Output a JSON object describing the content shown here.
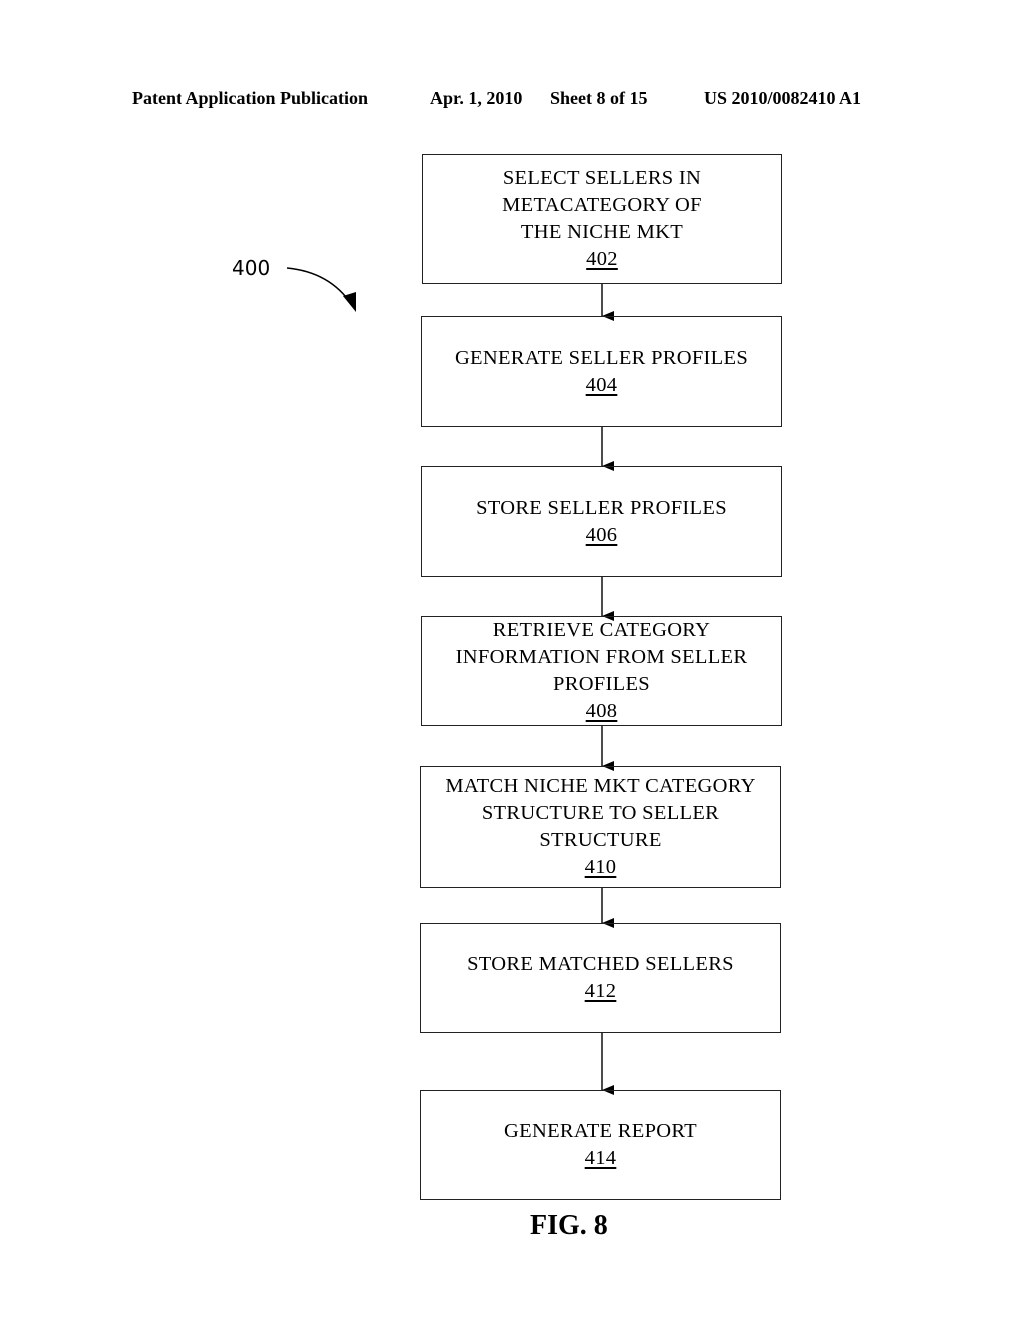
{
  "header": {
    "publication": "Patent Application Publication",
    "date": "Apr. 1, 2010",
    "sheet": "Sheet 8 of 15",
    "number": "US 2010/0082410 A1"
  },
  "diagram": {
    "reference_label": "400",
    "figure_label": "FIG. 8",
    "steps": [
      {
        "lines": [
          "SELECT SELLERS IN",
          "METACATEGORY OF",
          "THE NICHE MKT"
        ],
        "ref": "402"
      },
      {
        "lines": [
          "GENERATE SELLER PROFILES"
        ],
        "ref": "404"
      },
      {
        "lines": [
          "STORE SELLER PROFILES"
        ],
        "ref": "406"
      },
      {
        "lines": [
          "RETRIEVE CATEGORY",
          "INFORMATION FROM SELLER",
          "PROFILES"
        ],
        "ref": "408"
      },
      {
        "lines": [
          "MATCH NICHE MKT CATEGORY",
          "STRUCTURE TO SELLER",
          "STRUCTURE"
        ],
        "ref": "410"
      },
      {
        "lines": [
          "STORE MATCHED SELLERS"
        ],
        "ref": "412"
      },
      {
        "lines": [
          "GENERATE REPORT"
        ],
        "ref": "414"
      }
    ],
    "edges": [
      [
        "402",
        "404"
      ],
      [
        "404",
        "406"
      ],
      [
        "406",
        "408"
      ],
      [
        "408",
        "410"
      ],
      [
        "410",
        "412"
      ],
      [
        "412",
        "414"
      ]
    ]
  }
}
